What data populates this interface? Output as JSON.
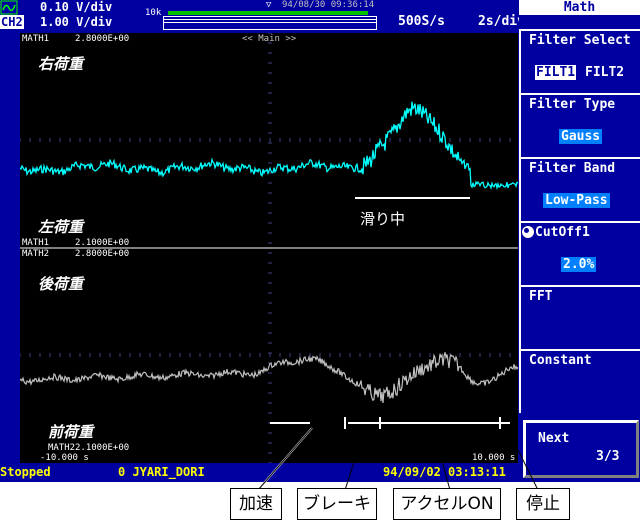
{
  "header": {
    "ch1_scale": "0.10 V/div",
    "ch2_label": "CH2",
    "ch2_scale": "1.00 V/div",
    "record_length": "10k",
    "trigger_datetime": "94/08/30 09:36:14",
    "sample_rate": "500S/s",
    "time_div": "2s/div",
    "math_title": "Math"
  },
  "plot": {
    "top_tag": "MATH1",
    "top_value": "2.8000E+00",
    "zoom_label": "<< Main >>",
    "upper_label_top": "右荷重",
    "upper_label_bottom": "左荷重",
    "mid_tag1": "MATH1",
    "mid_value1": "2.1000E+00",
    "mid_tag2": "MATH2",
    "mid_value2": "2.8000E+00",
    "lower_label_top": "後荷重",
    "lower_label_bottom": "前荷重",
    "bottom_tag": "MATH2",
    "bottom_value": "2.1000E+00",
    "time_left": "-10.000 s",
    "time_right": "10.000 s",
    "sliding_annotation": "滑り中",
    "ch1_color": "#00ffff",
    "ch2_color": "#c0c0c0"
  },
  "status": {
    "state": "Stopped",
    "file": "0 JYARI_DORI",
    "datetime": "94/09/02 03:13:11"
  },
  "menu": {
    "filter_select_label": "Filter Select",
    "filter_option_1": "FILT1",
    "filter_option_2": "FILT2",
    "filter_type_label": "Filter Type",
    "filter_type_value": "Gauss",
    "filter_band_label": "Filter Band",
    "filter_band_value": "Low-Pass",
    "cutoff_label": "CutOff1",
    "cutoff_value": "2.0%",
    "fft_label": "FFT",
    "constant_label": "Constant",
    "next_label": "Next",
    "next_page": "3/3"
  },
  "annotations": {
    "accel": "加速",
    "brake": "ブレーキ",
    "accel_on": "アクセルON",
    "stop": "停止"
  }
}
